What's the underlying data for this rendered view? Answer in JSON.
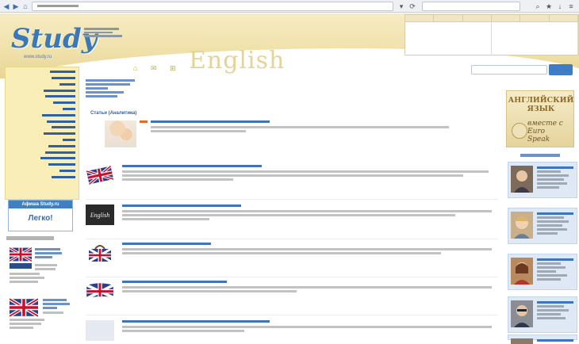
{
  "header": {
    "logo_text": "Study",
    "logo_url": "www.study.ru",
    "watermark": "English"
  },
  "afisha": {
    "title": "Афиша Study.ru",
    "body": "Легко!"
  },
  "main": {
    "section_title": "Статьи (Аналитика)"
  },
  "right_banner": {
    "title_line1": "АНГЛИЙСКИЙ",
    "title_line2": "ЯЗЫК",
    "subtitle": "вместе с Euro Speak"
  },
  "colors": {
    "accent_blue": "#3e7cc4",
    "header_yellow": "#f1e2ac",
    "sidebar_yellow": "#f9eeb8",
    "link_blue": "#2f5fa5"
  },
  "icons": [
    "back-arrow-icon",
    "forward-arrow-icon",
    "reload-icon",
    "search-icon",
    "bookmark-icon",
    "menu-icon",
    "uk-flag-icon"
  ]
}
